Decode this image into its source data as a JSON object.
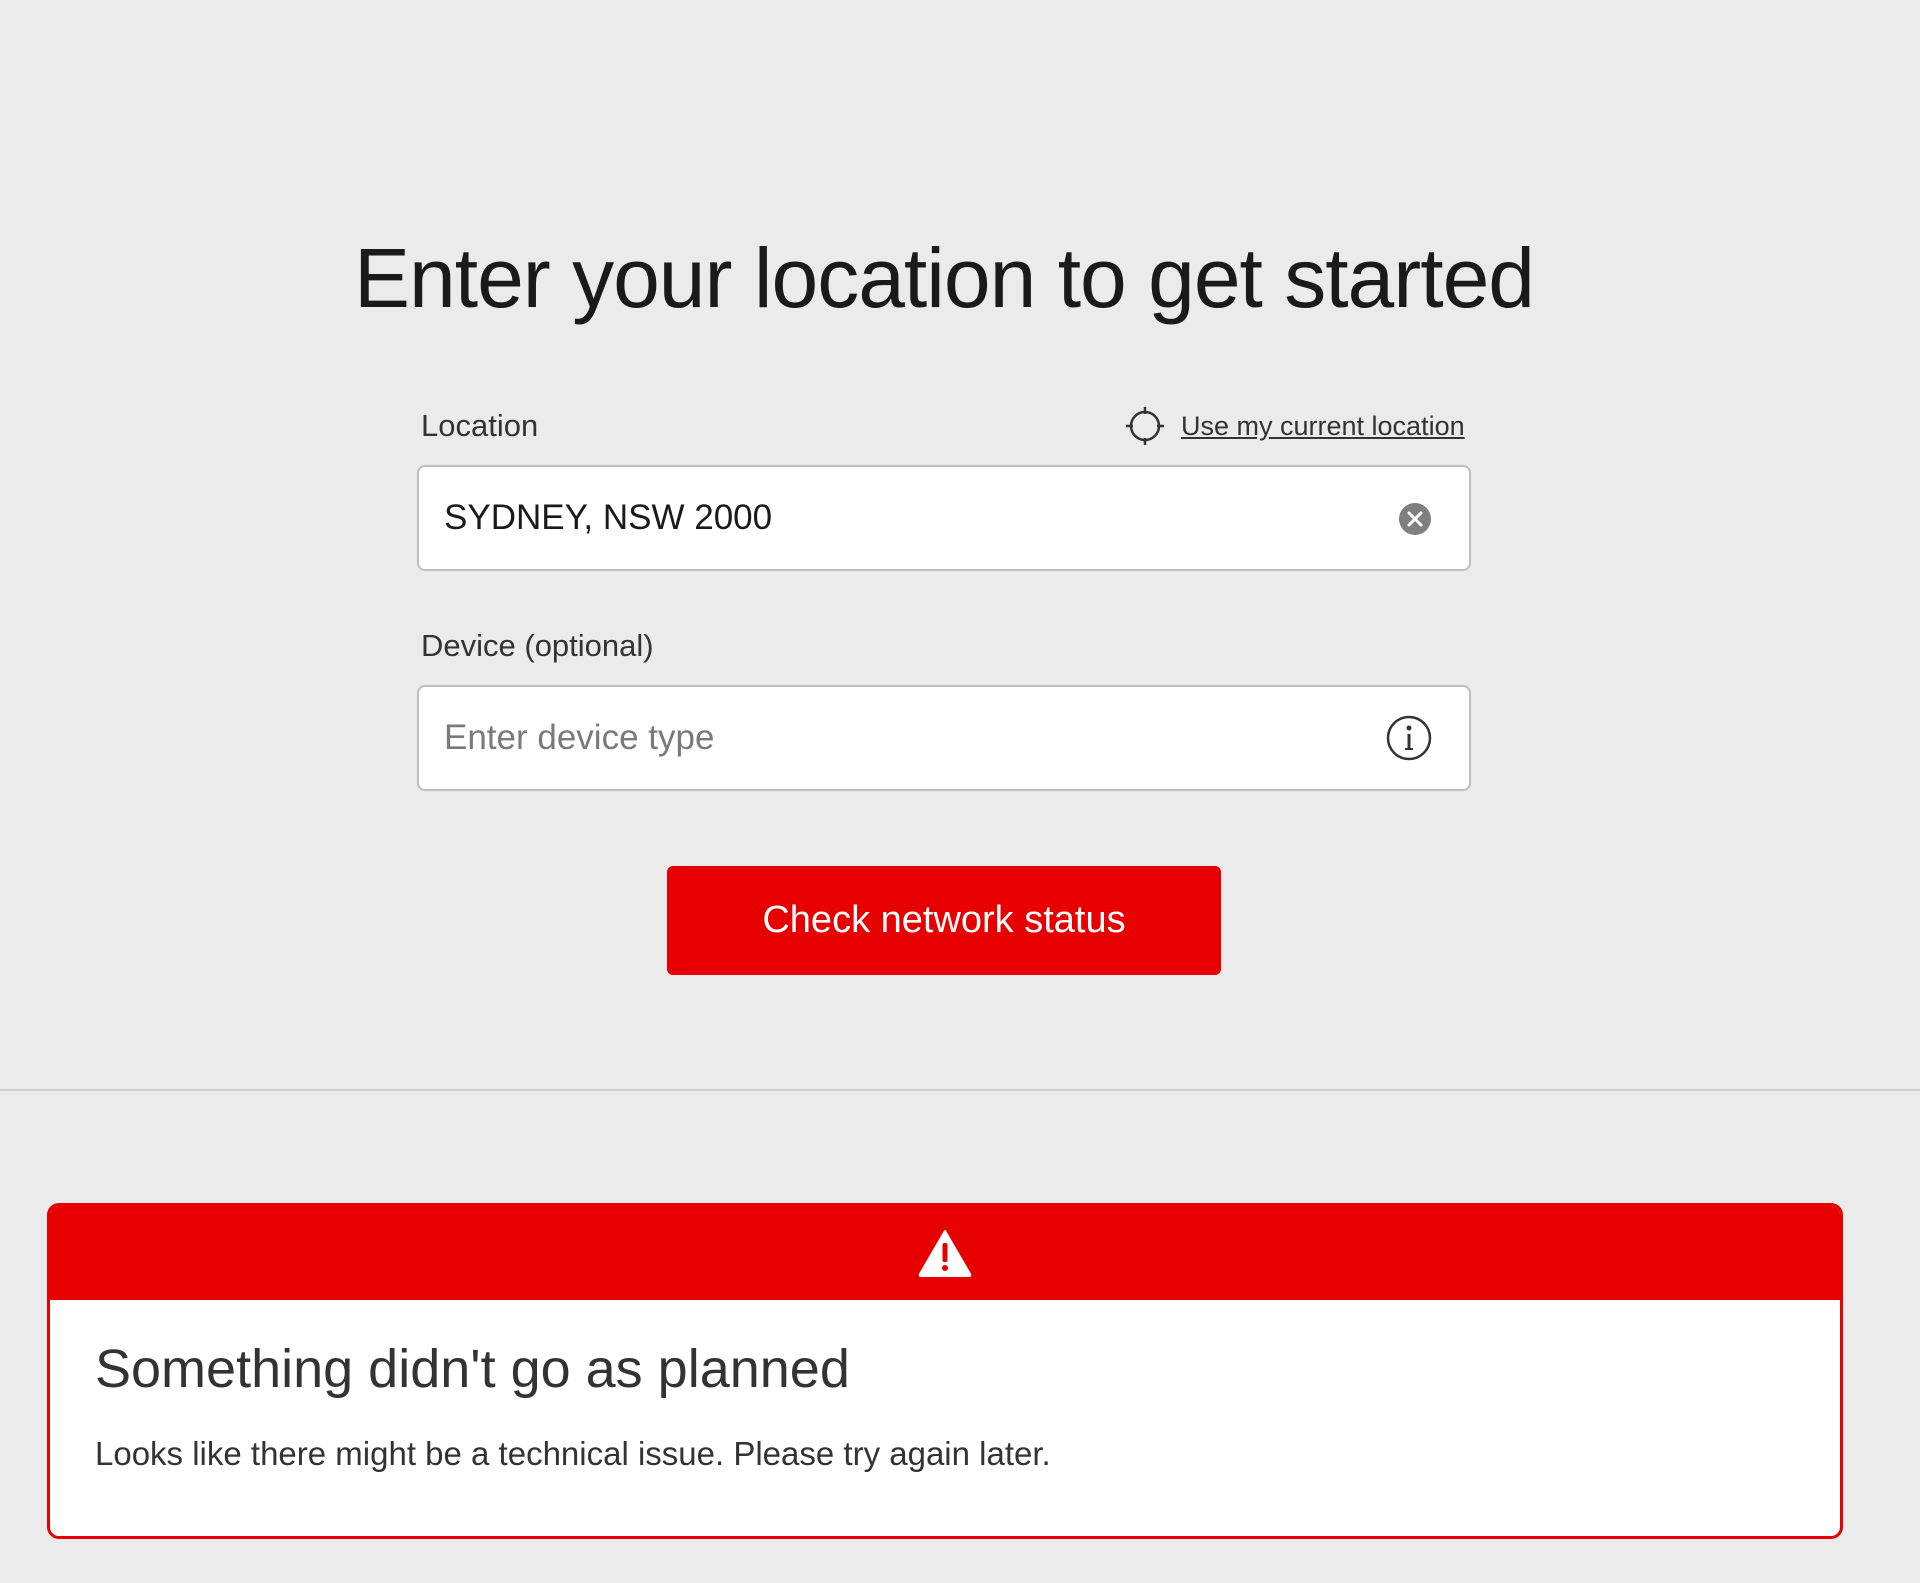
{
  "page": {
    "title": "Enter your location to get started"
  },
  "location": {
    "label": "Location",
    "use_current_location": "Use my current location",
    "value": "SYDNEY, NSW 2000",
    "placeholder": ""
  },
  "device": {
    "label": "Device (optional)",
    "value": "",
    "placeholder": "Enter device type"
  },
  "actions": {
    "check_network_status": "Check network status"
  },
  "alert": {
    "title": "Something didn't go as planned",
    "message": "Looks like there might be a technical issue. Please try again later."
  },
  "icons": {
    "current_location": "crosshair-icon",
    "clear": "clear-circle-icon",
    "info": "info-icon",
    "warning": "warning-triangle-icon"
  },
  "colors": {
    "brand_red": "#e60000",
    "background": "#ebebeb",
    "text": "#1a1a1a"
  }
}
